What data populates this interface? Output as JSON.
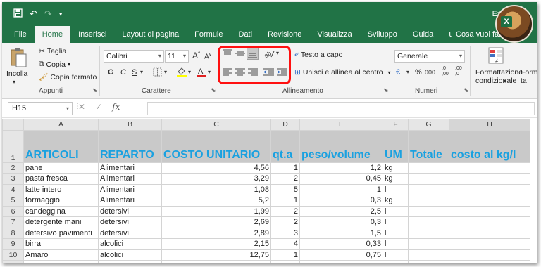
{
  "app": {
    "title_partial": "Exc",
    "quick_access": {
      "save": "save-icon",
      "undo": "↶",
      "redo": "↷",
      "customize": "▾"
    }
  },
  "tabs": [
    {
      "label": "File"
    },
    {
      "label": "Home"
    },
    {
      "label": "Inserisci"
    },
    {
      "label": "Layout di pagina"
    },
    {
      "label": "Formule"
    },
    {
      "label": "Dati"
    },
    {
      "label": "Revisione"
    },
    {
      "label": "Visualizza"
    },
    {
      "label": "Sviluppo"
    },
    {
      "label": "Guida"
    },
    {
      "label": "Cosa vuoi fare?"
    }
  ],
  "ribbon": {
    "clipboard": {
      "paste": "Incolla",
      "cut": "Taglia",
      "copy": "Copia",
      "format_painter": "Copia formato",
      "label": "Appunti"
    },
    "font": {
      "name": "Calibri",
      "size": "11",
      "grow": "A",
      "shrink": "A",
      "bold": "G",
      "italic": "C",
      "underline": "S",
      "label": "Carattere"
    },
    "alignment": {
      "wrap_text": "Testo a capo",
      "merge_center": "Unisci e allinea al centro",
      "label": "Allineamento"
    },
    "number": {
      "format": "Generale",
      "currency": "€",
      "percent": "%",
      "thousands": "000",
      "inc_dec": ",0 ,00",
      "dec_dec": ",00 ,0",
      "label": "Numeri"
    },
    "styles": {
      "conditional_1": "Formattazione",
      "conditional_2": "condizionale",
      "format_as": "Form",
      "format_as_2": "ta"
    }
  },
  "formula_bar": {
    "name_box": "H15",
    "fx": "fx",
    "content": ""
  },
  "sheet": {
    "columns": [
      "A",
      "B",
      "C",
      "D",
      "E",
      "F",
      "G",
      "H"
    ],
    "header": [
      "ARTICOLI",
      "REPARTO",
      "COSTO UNITARIO",
      "qt.a",
      "peso/volume",
      "UM",
      "Totale",
      "costo al kg/l"
    ],
    "rows": [
      {
        "n": "2",
        "a": "pane",
        "b": "Alimentari",
        "c": "4,56",
        "d": "1",
        "e": "1,2",
        "f": "kg"
      },
      {
        "n": "3",
        "a": "pasta fresca",
        "b": "Alimentari",
        "c": "3,29",
        "d": "2",
        "e": "0,45",
        "f": "kg"
      },
      {
        "n": "4",
        "a": "latte intero",
        "b": "Alimentari",
        "c": "1,08",
        "d": "5",
        "e": "1",
        "f": "l"
      },
      {
        "n": "5",
        "a": "formaggio",
        "b": "Alimentari",
        "c": "5,2",
        "d": "1",
        "e": "0,3",
        "f": "kg"
      },
      {
        "n": "6",
        "a": "candeggina",
        "b": "detersivi",
        "c": "1,99",
        "d": "2",
        "e": "2,5",
        "f": "l"
      },
      {
        "n": "7",
        "a": "detergente mani",
        "b": "detersivi",
        "c": "2,69",
        "d": "2",
        "e": "0,3",
        "f": "l"
      },
      {
        "n": "8",
        "a": "detersivo pavimenti",
        "b": "detersivi",
        "c": "2,89",
        "d": "3",
        "e": "1,5",
        "f": "l"
      },
      {
        "n": "9",
        "a": "birra",
        "b": "alcolici",
        "c": "2,15",
        "d": "4",
        "e": "0,33",
        "f": "l"
      },
      {
        "n": "10",
        "a": "Amaro",
        "b": "alcolici",
        "c": "12,75",
        "d": "1",
        "e": "0,75",
        "f": "l"
      }
    ]
  },
  "colors": {
    "excel_green": "#217346",
    "header_text": "#1aa1e0",
    "highlight": "#ff1010"
  }
}
